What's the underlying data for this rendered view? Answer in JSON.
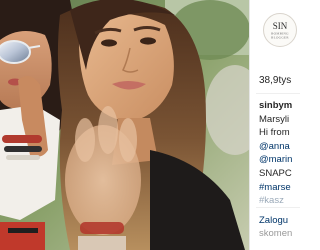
{
  "post": {
    "image_alt": "Selfie of two women at an outdoor event, one wearing sunglasses",
    "account_logo": {
      "line1": "SIN",
      "line2": "BOMBING",
      "line3": "BLOGGER"
    },
    "likes": "38,9tys",
    "caption_lines": [
      "sinbym",
      "Marsyli",
      "Hi from",
      "@anna",
      "@marin",
      "SNAPC",
      "#marse",
      "#kasz"
    ],
    "login_prompt": "Zalogu",
    "login_suffix": "skomen"
  },
  "colors": {
    "link": "#003569",
    "text": "#262626",
    "muted": "#999999"
  }
}
